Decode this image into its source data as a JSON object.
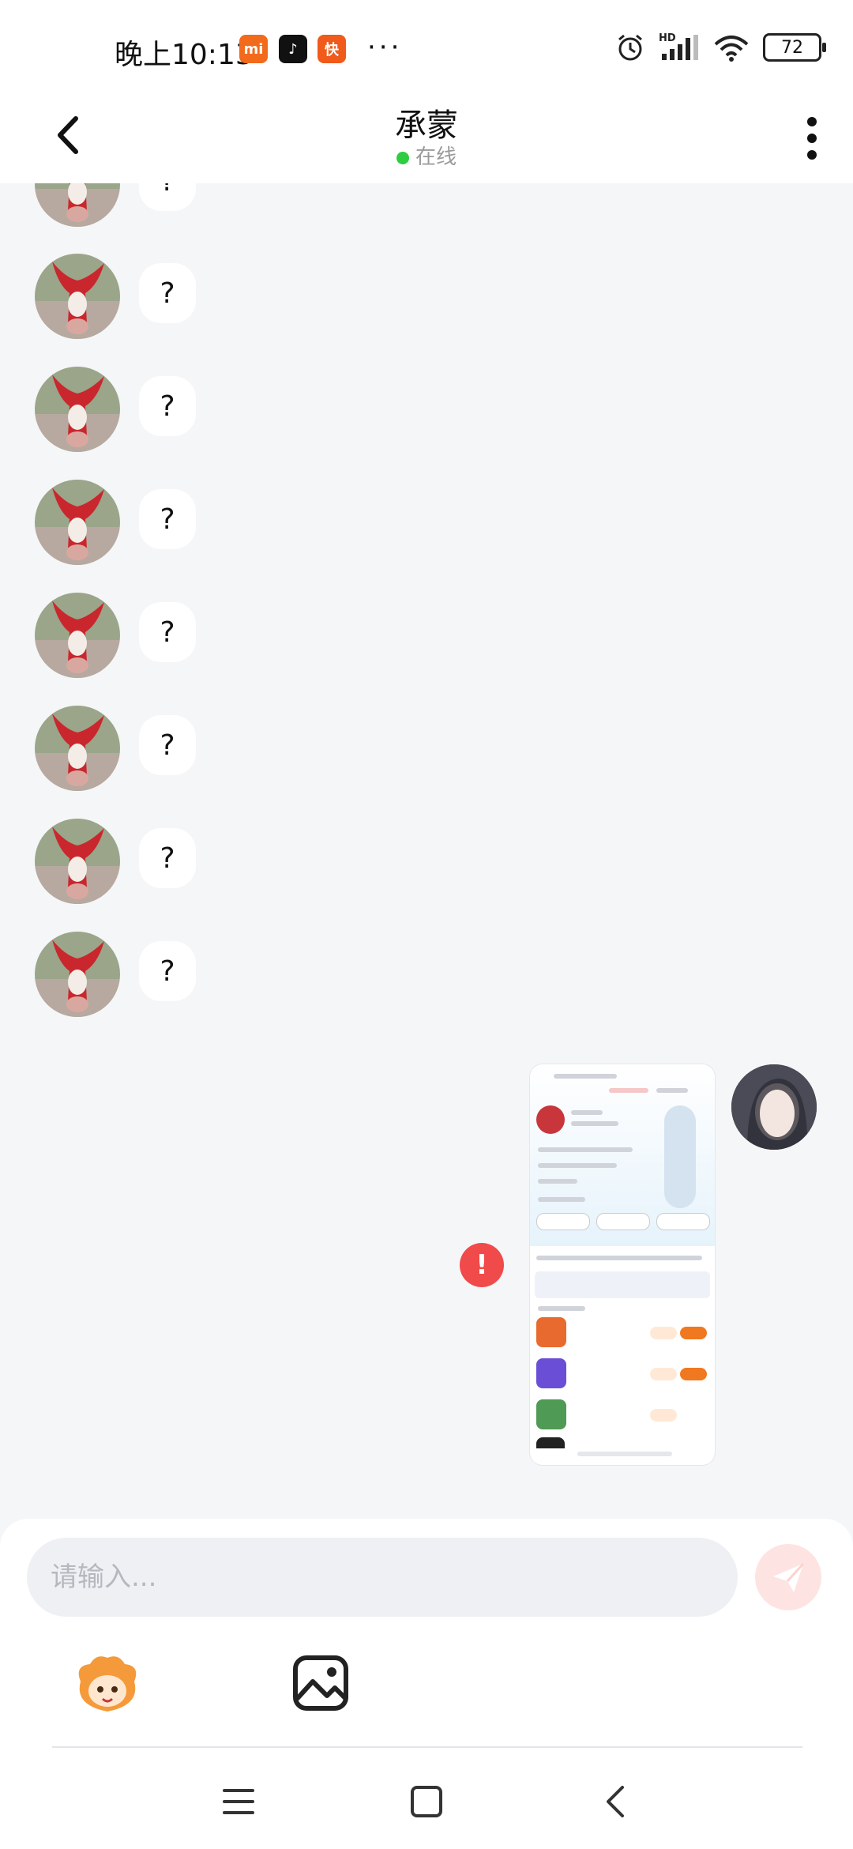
{
  "status_bar": {
    "time": "晚上10:13",
    "dots": "···",
    "hd": "HD",
    "battery": "72",
    "apps": [
      {
        "name": "mi",
        "label": "mi",
        "color": "#f26a1b"
      },
      {
        "name": "tiktok",
        "label": "♪",
        "color": "#111111"
      },
      {
        "name": "kuaishou",
        "label": "快",
        "color": "#f05a1a"
      }
    ]
  },
  "header": {
    "title": "承蒙",
    "status": "在线"
  },
  "messages": {
    "incoming_text": "?",
    "count": 8
  },
  "outgoing": {
    "error_symbol": "!"
  },
  "input": {
    "placeholder": "请输入..."
  },
  "colors": {
    "accent": "#f04a4a",
    "online": "#2ecc40",
    "orange": "#f07820"
  }
}
